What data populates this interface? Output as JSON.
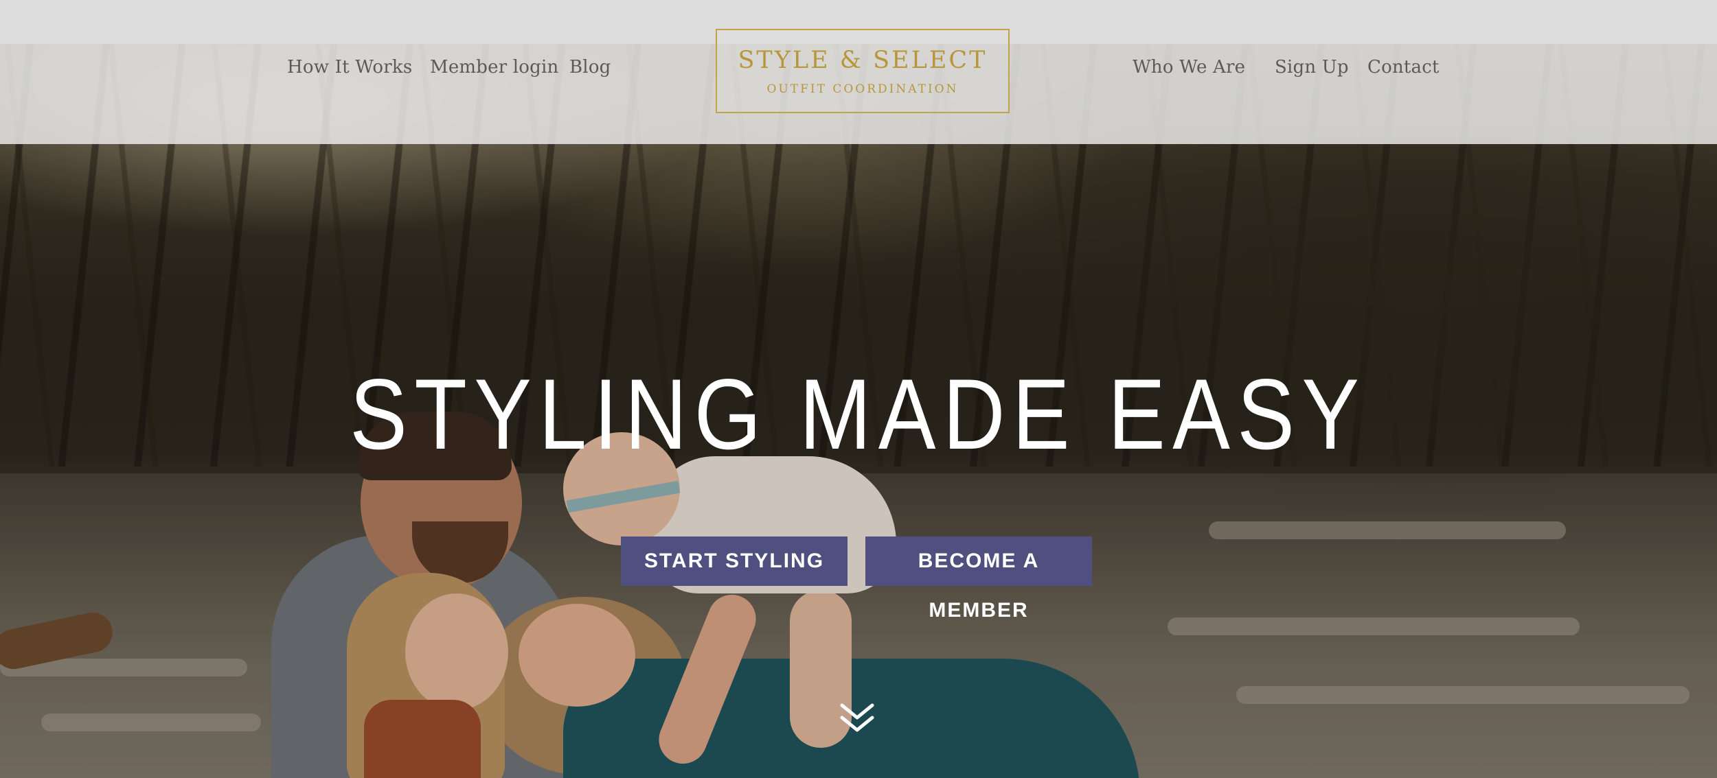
{
  "header": {
    "logo": {
      "title": "STYLE & SELECT",
      "subtitle": "OUTFIT COORDINATION",
      "color": "#b8963a"
    },
    "nav_left": [
      {
        "label": "How It Works"
      },
      {
        "label": "Member login"
      },
      {
        "label": "Blog"
      }
    ],
    "nav_right": [
      {
        "label": "Who We Are"
      },
      {
        "label": "Sign Up"
      },
      {
        "label": "Contact"
      }
    ]
  },
  "hero": {
    "headline": "STYLING MADE EASY",
    "buttons": [
      {
        "label": "START STYLING"
      },
      {
        "label": "BECOME A MEMBER"
      }
    ],
    "button_color": "#4f4f80",
    "scroll_icon": "double-chevron-down-icon"
  }
}
